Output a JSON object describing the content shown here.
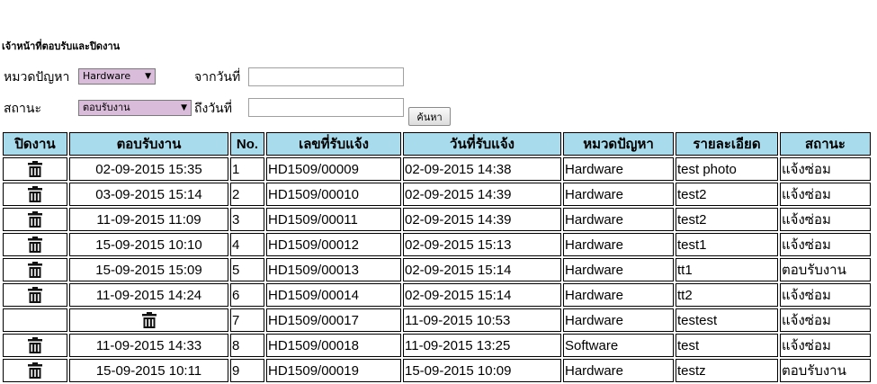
{
  "page_title": "เจ้าหน้าที่ตอบรับและปิดงาน",
  "filters": {
    "category_label": "หมวดปัญหา",
    "category_value": "Hardware",
    "from_date_label": "จากวันที่",
    "from_date_value": "",
    "status_label": "สถานะ",
    "status_value": "ตอบรับงาน",
    "to_date_label": "ถึงวันที่",
    "to_date_value": "",
    "search_button": "ค้นหา"
  },
  "table": {
    "headers": [
      "ปิดงาน",
      "ตอบรับงาน",
      "No.",
      "เลขที่รับแจ้ง",
      "วันที่รับแจ้ง",
      "หมวดปัญหา",
      "รายละเอียด",
      "สถานะ"
    ],
    "rows": [
      {
        "accepted": "02-09-2015 15:35",
        "no": "1",
        "ticket": "HD1509/00009",
        "date": "02-09-2015 14:38",
        "category": "Hardware",
        "detail": "test photo",
        "status": "แจ้งซ่อม"
      },
      {
        "accepted": "03-09-2015 15:14",
        "no": "2",
        "ticket": "HD1509/00010",
        "date": "02-09-2015 14:39",
        "category": "Hardware",
        "detail": "test2",
        "status": "แจ้งซ่อม"
      },
      {
        "accepted": "11-09-2015 11:09",
        "no": "3",
        "ticket": "HD1509/00011",
        "date": "02-09-2015 14:39",
        "category": "Hardware",
        "detail": "test2",
        "status": "แจ้งซ่อม"
      },
      {
        "accepted": "15-09-2015 10:10",
        "no": "4",
        "ticket": "HD1509/00012",
        "date": "02-09-2015 15:13",
        "category": "Hardware",
        "detail": "test1",
        "status": "แจ้งซ่อม"
      },
      {
        "accepted": "15-09-2015 15:09",
        "no": "5",
        "ticket": "HD1509/00013",
        "date": "02-09-2015 15:14",
        "category": "Hardware",
        "detail": "tt1",
        "status": "ตอบรับงาน"
      },
      {
        "accepted": "11-09-2015 14:24",
        "no": "6",
        "ticket": "HD1509/00014",
        "date": "02-09-2015 15:14",
        "category": "Hardware",
        "detail": "tt2",
        "status": "แจ้งซ่อม"
      },
      {
        "accepted": "",
        "no": "7",
        "ticket": "HD1509/00017",
        "date": "11-09-2015 10:53",
        "category": "Hardware",
        "detail": "testest",
        "status": "แจ้งซ่อม"
      },
      {
        "accepted": "11-09-2015 14:33",
        "no": "8",
        "ticket": "HD1509/00018",
        "date": "11-09-2015 13:25",
        "category": "Software",
        "detail": "test",
        "status": "แจ้งซ่อม"
      },
      {
        "accepted": "15-09-2015 10:11",
        "no": "9",
        "ticket": "HD1509/00019",
        "date": "15-09-2015 10:09",
        "category": "Hardware",
        "detail": "testz",
        "status": "ตอบรับงาน"
      }
    ]
  },
  "colors": {
    "header_bg": "#a8dcec",
    "select_bg": "#d9bcd9"
  },
  "icons": {
    "close_job": "trash-icon",
    "accept_job": "trash-icon",
    "dropdown": "chevron-down-icon"
  }
}
